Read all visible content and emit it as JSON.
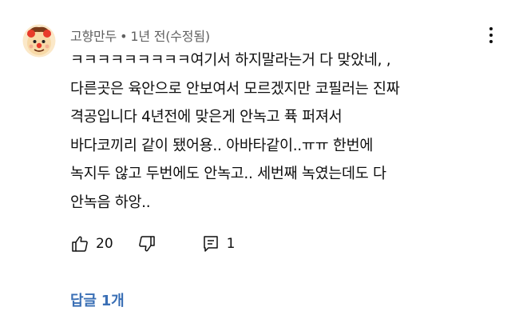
{
  "comment": {
    "author": "고향만두",
    "separator": "•",
    "time": "1년 전(수정됨)",
    "lines": [
      "ㅋㅋㅋㅋㅋㅋㅋㅋㅋ여기서 하지말라는거 다 맞았네, ,",
      "다른곳은 육안으로 안보여서 모르겠지만 코필러는 진짜",
      "격공입니다 4년전에 맞은게 안녹고 퓩 퍼져서",
      "바다코끼리 같이 됐어용..  아바타같이..ㅠㅠ 한번에",
      "녹지두 않고 두번에도 안녹고.. 세번째 녹였는데도 다",
      "안녹음 하앙.."
    ],
    "like_count": "20",
    "reply_count": "1",
    "replies_link": "답글 1개"
  },
  "icons": {
    "avatar": "cartoon-face-avatar",
    "more": "more-vertical-icon",
    "like": "thumbs-up-icon",
    "dislike": "thumbs-down-icon",
    "reply": "comment-icon"
  },
  "colors": {
    "meta_text": "#606060",
    "body_text": "#0f0f0f",
    "link": "#3a6fb5"
  }
}
